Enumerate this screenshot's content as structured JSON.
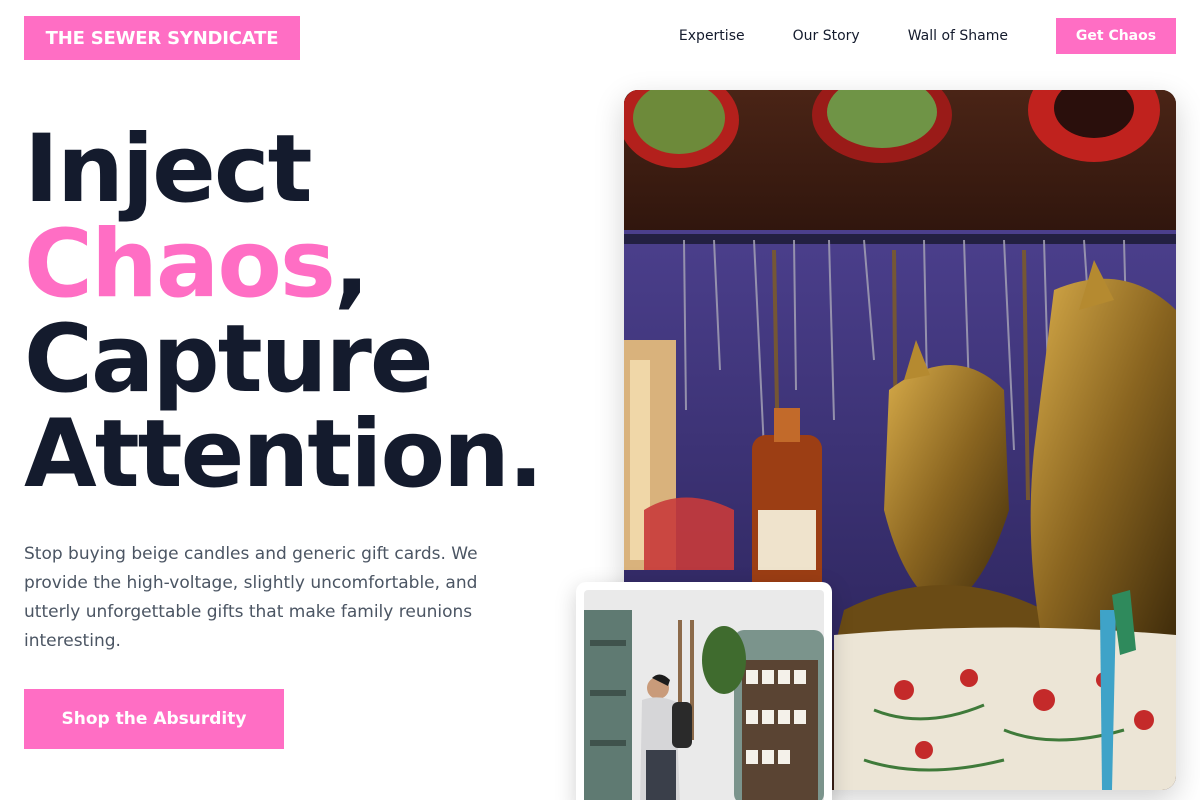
{
  "brand": {
    "logo_text": "THE SEWER SYNDICATE",
    "accent": "#ff6ec4",
    "dark": "#141b2d"
  },
  "nav": {
    "items": [
      {
        "label": "Expertise"
      },
      {
        "label": "Our Story"
      },
      {
        "label": "Wall of Shame"
      }
    ],
    "cta_label": "Get Chaos"
  },
  "hero": {
    "line1": "Inject",
    "line2_accent": "Chaos",
    "line2_punct": ",",
    "line3": "Capture",
    "line4": "Attention.",
    "lead": "Stop buying beige candles and generic gift cards. We provide the high-voltage, slightly uncomfortable, and utterly unforgettable gifts that make family reunions interesting.",
    "button_label": "Shop the Absurdity"
  },
  "images": {
    "main": "souvenir-market-stall-photo",
    "inset": "gift-shop-customer-photo"
  }
}
